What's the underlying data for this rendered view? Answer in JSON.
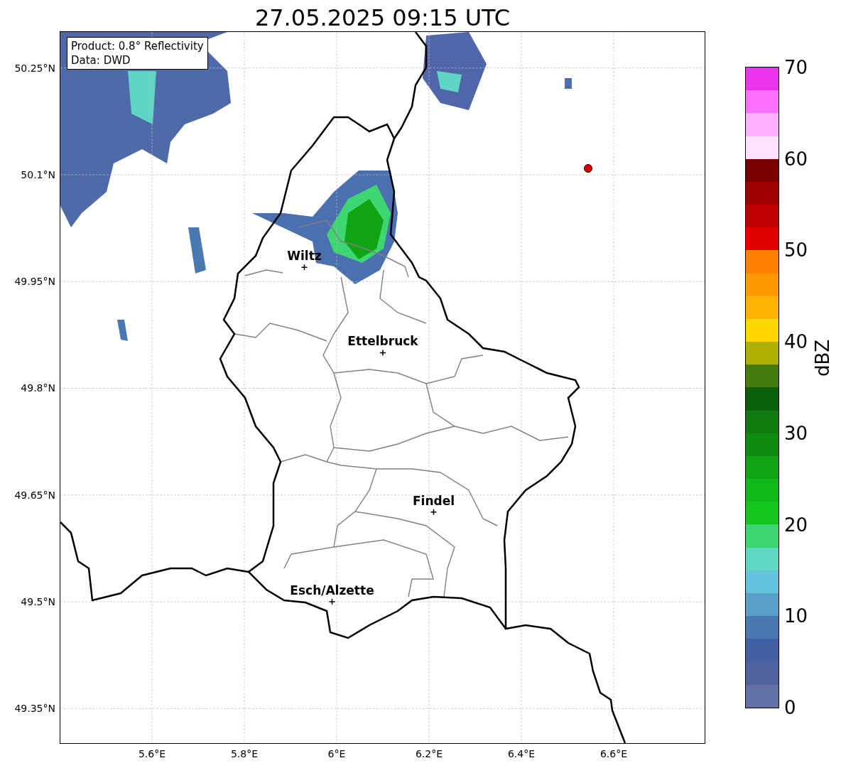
{
  "title": "27.05.2025 09:15 UTC",
  "legend": [
    "Product: 0.8° Reflectivity",
    "Data: DWD"
  ],
  "map": {
    "cities": [
      {
        "name": "Wiltz"
      },
      {
        "name": "Ettelbruck"
      },
      {
        "name": "Findel"
      },
      {
        "name": "Esch/Alzette"
      }
    ]
  },
  "y_ticks": [
    "50.25°N",
    "50.1°N",
    "49.95°N",
    "49.8°N",
    "49.65°N",
    "49.5°N",
    "49.35°N"
  ],
  "x_ticks": [
    "5.6°E",
    "5.8°E",
    "6°E",
    "6.2°E",
    "6.4°E",
    "6.6°E"
  ],
  "colorbar": {
    "label": "dBZ",
    "ticks": [
      "70",
      "60",
      "50",
      "40",
      "30",
      "20",
      "10",
      "0"
    ],
    "bins": [
      {
        "color": "#ee33ee"
      },
      {
        "color": "#ff70ff"
      },
      {
        "color": "#ffb0ff"
      },
      {
        "color": "#ffe0ff"
      },
      {
        "color": "#7a0000"
      },
      {
        "color": "#a00000"
      },
      {
        "color": "#c00000"
      },
      {
        "color": "#e00000"
      },
      {
        "color": "#ff7f00"
      },
      {
        "color": "#ff9900"
      },
      {
        "color": "#ffb300"
      },
      {
        "color": "#ffd700"
      },
      {
        "color": "#b0b000"
      },
      {
        "color": "#457a0d"
      },
      {
        "color": "#0b5f0b"
      },
      {
        "color": "#0f7a10"
      },
      {
        "color": "#0e8c10"
      },
      {
        "color": "#10a414"
      },
      {
        "color": "#11b81a"
      },
      {
        "color": "#12c81c"
      },
      {
        "color": "#3ed672"
      },
      {
        "color": "#5fd8c2"
      },
      {
        "color": "#65c2dc"
      },
      {
        "color": "#5aa0c8"
      },
      {
        "color": "#4a78b0"
      },
      {
        "color": "#4460a4"
      },
      {
        "color": "#4f63a0"
      },
      {
        "color": "#6371a6"
      }
    ]
  }
}
